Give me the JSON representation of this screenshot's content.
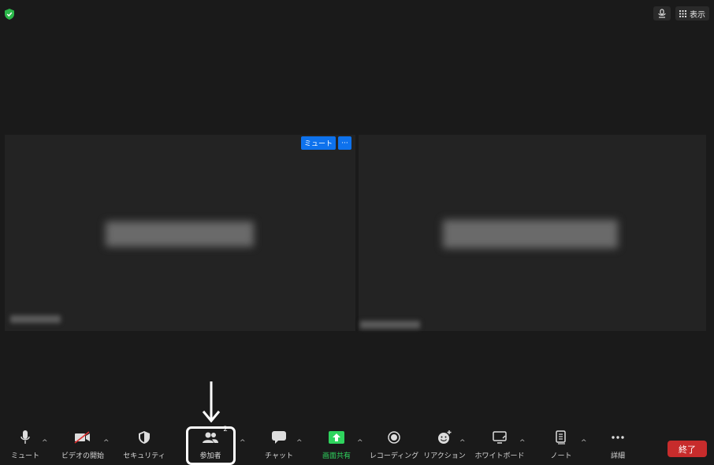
{
  "topbar": {
    "view_label": "表示",
    "icons": [
      "security-shield-icon",
      "mic-signal-icon",
      "grid-icon"
    ]
  },
  "tiles": {
    "left": {
      "mute_chip": "ミュート",
      "more_chip": "···"
    },
    "right": {}
  },
  "toolbar": {
    "mute": "ミュート",
    "video": "ビデオの開始",
    "security": "セキュリティ",
    "participants": "参加者",
    "participants_count": "2",
    "chat": "チャット",
    "share": "画面共有",
    "record": "レコーディング",
    "reactions": "リアクション",
    "whiteboard": "ホワイトボード",
    "notes": "ノート",
    "more": "詳細",
    "end": "終了",
    "caret": "^"
  },
  "colors": {
    "background": "#1a1a1a",
    "tile": "#232323",
    "accent_blue": "#0e72ed",
    "share_green": "#2fd45e",
    "end_red": "#c72c2c",
    "secure_green": "#2bb84a"
  }
}
